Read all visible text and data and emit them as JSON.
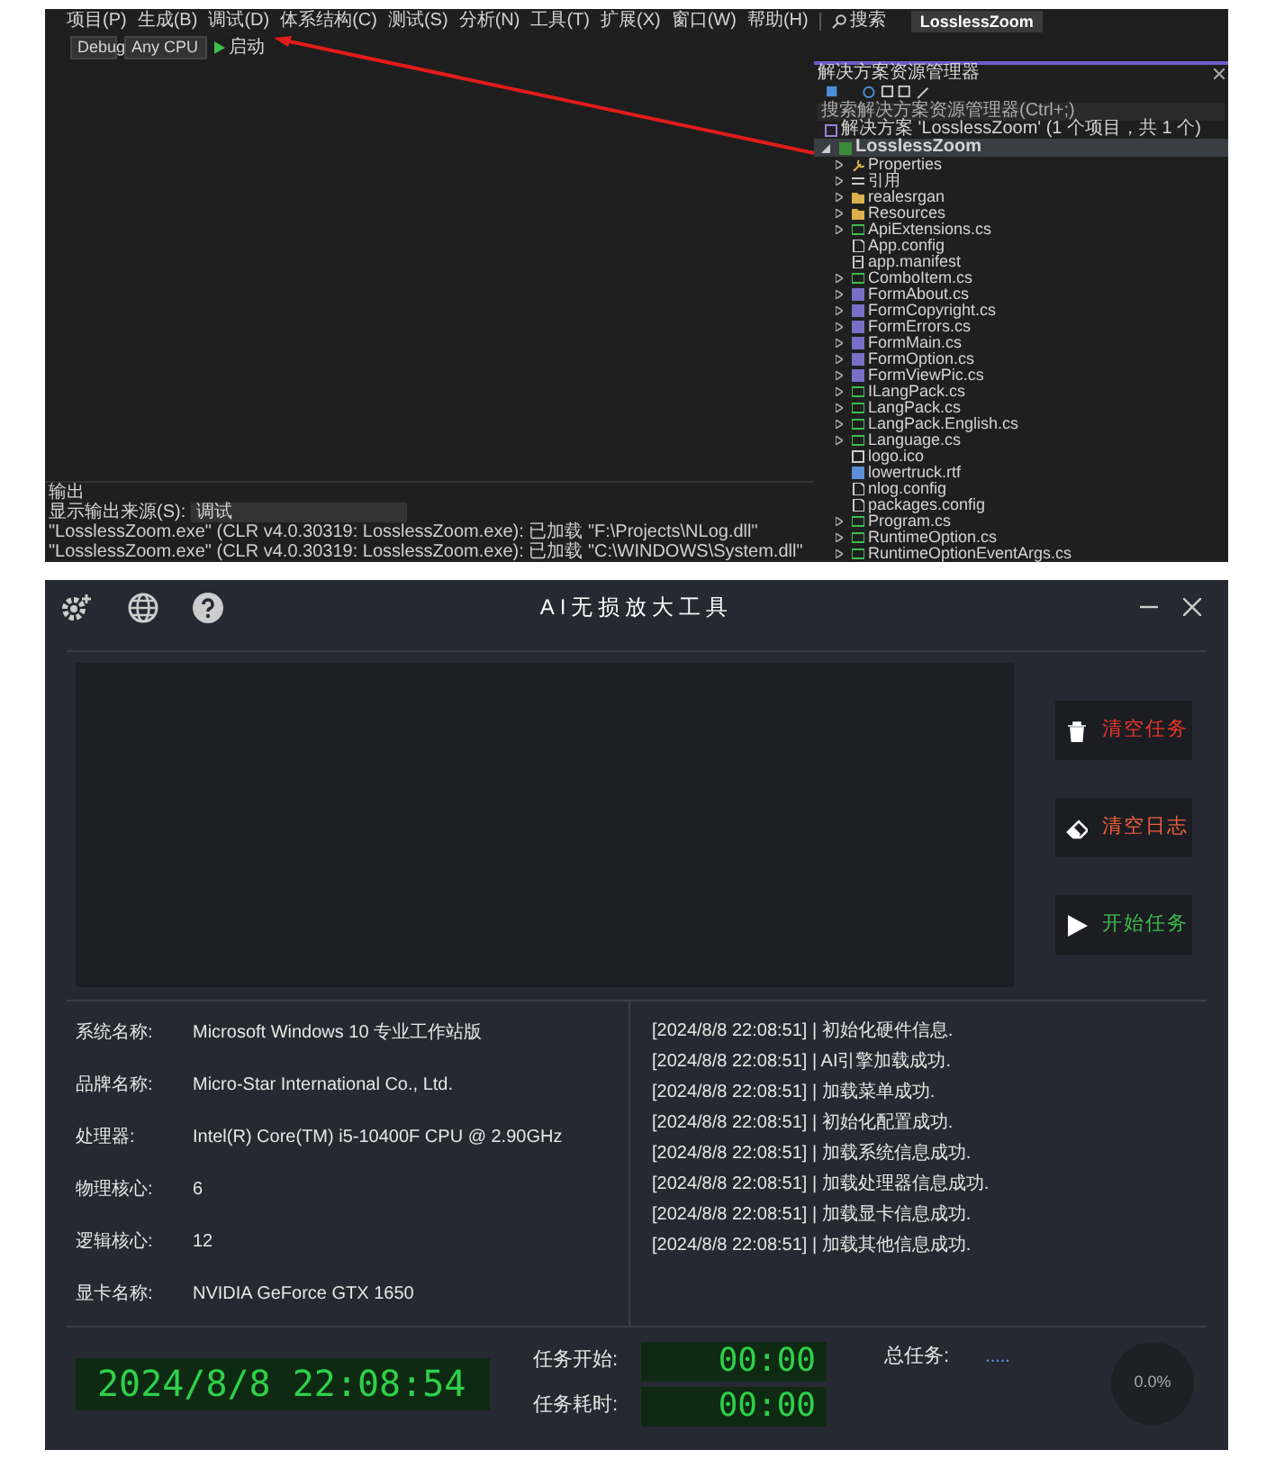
{
  "ide": {
    "menu": [
      "项目(P)",
      "生成(B)",
      "调试(D)",
      "体系结构(C)",
      "测试(S)",
      "分析(N)",
      "工具(T)",
      "扩展(X)",
      "窗口(W)",
      "帮助(H)"
    ],
    "search": "搜索",
    "project_badge": "LosslessZoom",
    "toolbar": {
      "configuration": "Debug",
      "platform": "Any CPU",
      "run": "启动"
    },
    "solution_explorer": {
      "title": "解决方案资源管理器",
      "search_placeholder": "搜索解决方案资源管理器(Ctrl+;)",
      "solution": "解决方案 'LosslessZoom' (1 个项目，共 1 个)",
      "project": "LosslessZoom",
      "items": [
        {
          "label": "Properties",
          "kind": "properties",
          "expandable": true
        },
        {
          "label": "引用",
          "kind": "references",
          "expandable": true
        },
        {
          "label": "realesrgan",
          "kind": "folder",
          "expandable": true
        },
        {
          "label": "Resources",
          "kind": "folder",
          "expandable": true
        },
        {
          "label": "ApiExtensions.cs",
          "kind": "cs",
          "expandable": true
        },
        {
          "label": "App.config",
          "kind": "config",
          "expandable": false
        },
        {
          "label": "app.manifest",
          "kind": "manifest",
          "expandable": false
        },
        {
          "label": "ComboItem.cs",
          "kind": "cs",
          "expandable": true
        },
        {
          "label": "FormAbout.cs",
          "kind": "form",
          "expandable": true
        },
        {
          "label": "FormCopyright.cs",
          "kind": "form",
          "expandable": true
        },
        {
          "label": "FormErrors.cs",
          "kind": "form",
          "expandable": true
        },
        {
          "label": "FormMain.cs",
          "kind": "form",
          "expandable": true
        },
        {
          "label": "FormOption.cs",
          "kind": "form",
          "expandable": true
        },
        {
          "label": "FormViewPic.cs",
          "kind": "form",
          "expandable": true
        },
        {
          "label": "ILangPack.cs",
          "kind": "cs",
          "expandable": true
        },
        {
          "label": "LangPack.cs",
          "kind": "cs",
          "expandable": true
        },
        {
          "label": "LangPack.English.cs",
          "kind": "cs",
          "expandable": true
        },
        {
          "label": "Language.cs",
          "kind": "cs",
          "expandable": true
        },
        {
          "label": "logo.ico",
          "kind": "file",
          "expandable": false
        },
        {
          "label": "lowertruck.rtf",
          "kind": "doc",
          "expandable": false
        },
        {
          "label": "nlog.config",
          "kind": "config",
          "expandable": false
        },
        {
          "label": "packages.config",
          "kind": "config",
          "expandable": false
        },
        {
          "label": "Program.cs",
          "kind": "cs",
          "expandable": true
        },
        {
          "label": "RuntimeOption.cs",
          "kind": "cs",
          "expandable": true
        },
        {
          "label": "RuntimeOptionEventArgs.cs",
          "kind": "cs",
          "expandable": true
        }
      ]
    },
    "output": {
      "title": "输出",
      "source_label": "显示输出来源(S):",
      "source": "调试",
      "lines": [
        "\"LosslessZoom.exe\" (CLR v4.0.30319: LosslessZoom.exe): 已加载 \"F:\\Projects\\NLog.dll\"",
        "\"LosslessZoom.exe\" (CLR v4.0.30319: LosslessZoom.exe): 已加载 \"C:\\WINDOWS\\System.dll\""
      ]
    }
  },
  "app": {
    "title": "AI无损放大工具",
    "buttons": [
      {
        "label": "清空任务",
        "kind": "trash",
        "color": "#e8352a"
      },
      {
        "label": "清空日志",
        "kind": "eraser",
        "color": "#f0603a"
      },
      {
        "label": "开始任务",
        "kind": "play",
        "color": "#3dbb4a"
      }
    ],
    "info": [
      {
        "label": "系统名称:",
        "value": "Microsoft Windows 10 专业工作站版"
      },
      {
        "label": "品牌名称:",
        "value": "Micro-Star International Co., Ltd."
      },
      {
        "label": "处理器:",
        "value": "Intel(R) Core(TM) i5-10400F CPU @ 2.90GHz"
      },
      {
        "label": "物理核心:",
        "value": "6"
      },
      {
        "label": "逻辑核心:",
        "value": "12"
      },
      {
        "label": "显卡名称:",
        "value": "NVIDIA GeForce GTX 1650"
      }
    ],
    "log": [
      "[2024/8/8 22:08:51] | 初始化硬件信息.",
      "[2024/8/8 22:08:51] | AI引擎加载成功.",
      "[2024/8/8 22:08:51] | 加载菜单成功.",
      "[2024/8/8 22:08:51] | 初始化配置成功.",
      "[2024/8/8 22:08:51] | 加载系统信息成功.",
      "[2024/8/8 22:08:51] | 加载处理器信息成功.",
      "[2024/8/8 22:08:51] | 加载显卡信息成功.",
      "[2024/8/8 22:08:51] | 加载其他信息成功."
    ],
    "clock": "2024/8/8 22:08:54",
    "timers": [
      {
        "label": "任务开始:",
        "value": "00:00"
      },
      {
        "label": "任务耗时:",
        "value": "00:00"
      }
    ],
    "total": {
      "label": "总任务:",
      "value": "....."
    },
    "progress": "0.0%"
  }
}
